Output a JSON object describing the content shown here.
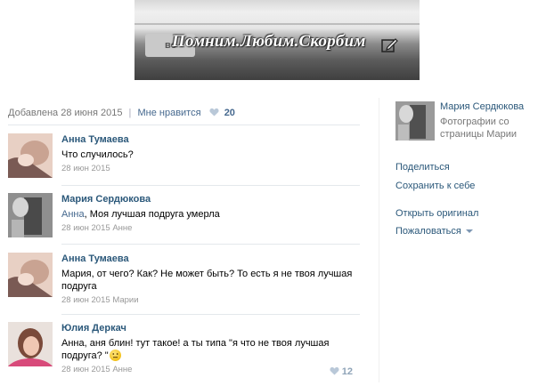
{
  "banner": {
    "button_text": "во",
    "caption": "Помним.Любим.Скорбим"
  },
  "post_meta": {
    "added": "Добавлена 28 июня 2015",
    "separator": "|",
    "like_label": "Мне нравится",
    "like_count": "20"
  },
  "comments": [
    {
      "author": "Анна Тумаева",
      "mention": "",
      "text": "Что случилось?",
      "date": "28 июн 2015",
      "reply_to": "",
      "likes": ""
    },
    {
      "author": "Мария Сердюкова",
      "mention": "Анна",
      "text": ", Моя лучшая подруга умерла",
      "date": "28 июн 2015",
      "reply_to": "Анне",
      "likes": ""
    },
    {
      "author": "Анна Тумаева",
      "mention": "",
      "text": "Мария, от чего? Как? Не может быть? То есть я не твоя лучшая подруга",
      "date": "28 июн 2015",
      "reply_to": "Марии",
      "likes": ""
    },
    {
      "author": "Юлия Деркач",
      "mention": "",
      "text": "Анна, аня блин! тут такое! а ты типа \"я что не твоя лучшая подруга? \"",
      "date": "28 июн 2015",
      "reply_to": "Анне",
      "likes": "12"
    }
  ],
  "sidebar": {
    "owner_name": "Мария Сердюкова",
    "album_desc": "Фотографии со страницы Марии",
    "share": "Поделиться",
    "save": "Сохранить к себе",
    "open_original": "Открыть оригинал",
    "report": "Пожаловаться"
  },
  "icons": {
    "heart": "heart-icon",
    "edit": "edit-icon",
    "smile": "smile-emoji-icon",
    "dropdown": "chevron-down-icon"
  },
  "colors": {
    "link": "#2b587a",
    "meta_gray": "#777777",
    "heart": "#b9c8d8"
  }
}
